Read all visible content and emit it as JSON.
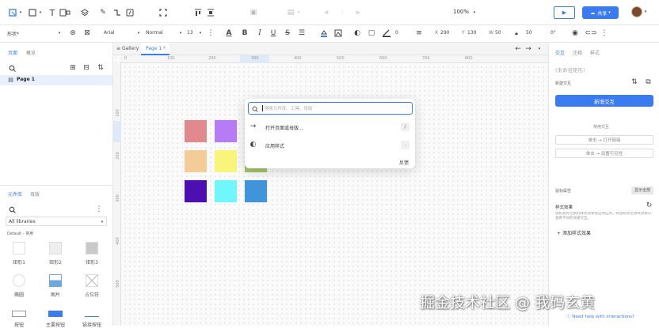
{
  "toolbar": {
    "zoom": "100%",
    "share_label": "共享",
    "colors": {
      "accent": "#3a7bf0"
    }
  },
  "style_bar": {
    "shape_name": "形状*",
    "font": "Arial",
    "weight": "Normal",
    "size": "13",
    "line_width": "0",
    "x_label": "X",
    "x": "290",
    "y_label": "Y",
    "y": "130",
    "w_label": "W",
    "w": "50",
    "h": "50",
    "rotation": "0°"
  },
  "left_panel": {
    "tabs": [
      "页面",
      "概览"
    ],
    "pages": [
      "Page 1"
    ],
    "lib_tabs": [
      "元件库",
      "母版"
    ],
    "library_select": "All libraries",
    "library_group": "Default - 常用",
    "items": [
      "矩形1",
      "矩形2",
      "矩形3",
      "椭圆",
      "图片",
      "占位符",
      "按钮",
      "主要按钮",
      "链接按钮"
    ]
  },
  "canvas_tabs": {
    "gallery": "Gallery",
    "page": "Page 1"
  },
  "rulers": {
    "h_ticks": [
      "0",
      "100",
      "200",
      "300",
      "400",
      "500",
      "600",
      "700",
      "800"
    ],
    "v_ticks": [
      "100",
      "200",
      "300",
      "400",
      "500"
    ]
  },
  "swatches": [
    "#e08a8f",
    "#b67cf5",
    "#f4cc98",
    "#f8f57a",
    "#a8c46a",
    "#4d0fb0",
    "#6ff7fb",
    "#3f94da"
  ],
  "modal": {
    "search_placeholder": "搜索元件库、工具、母版",
    "items": [
      {
        "label": "打开页面或母版...",
        "shortcut": "/"
      },
      {
        "label": "应用样式",
        "shortcut": "."
      }
    ],
    "feedback": "反馈"
  },
  "right_panel": {
    "tabs": [
      "交互",
      "注释",
      "样式"
    ],
    "shape_name": "(未命名矩形)",
    "section_interactions": "新建交互",
    "new_interaction": "新增交互",
    "common_label": "常用交互",
    "common_items": [
      "单击 → 打开链接",
      "单击 → 设置可见性"
    ],
    "style_effects_title": "鼠标属性",
    "show_all": "显示全部",
    "style_effects": "样式效果",
    "style_desc": "鼠标悬停之类的样式效果会自动应用，将鼠标移至样式效果以查看不同的效果交互。",
    "add_style_effect": "添加样式效果",
    "help": "Need help with interactions?"
  },
  "watermark": "掘金技术社区 @ 我码玄黄"
}
